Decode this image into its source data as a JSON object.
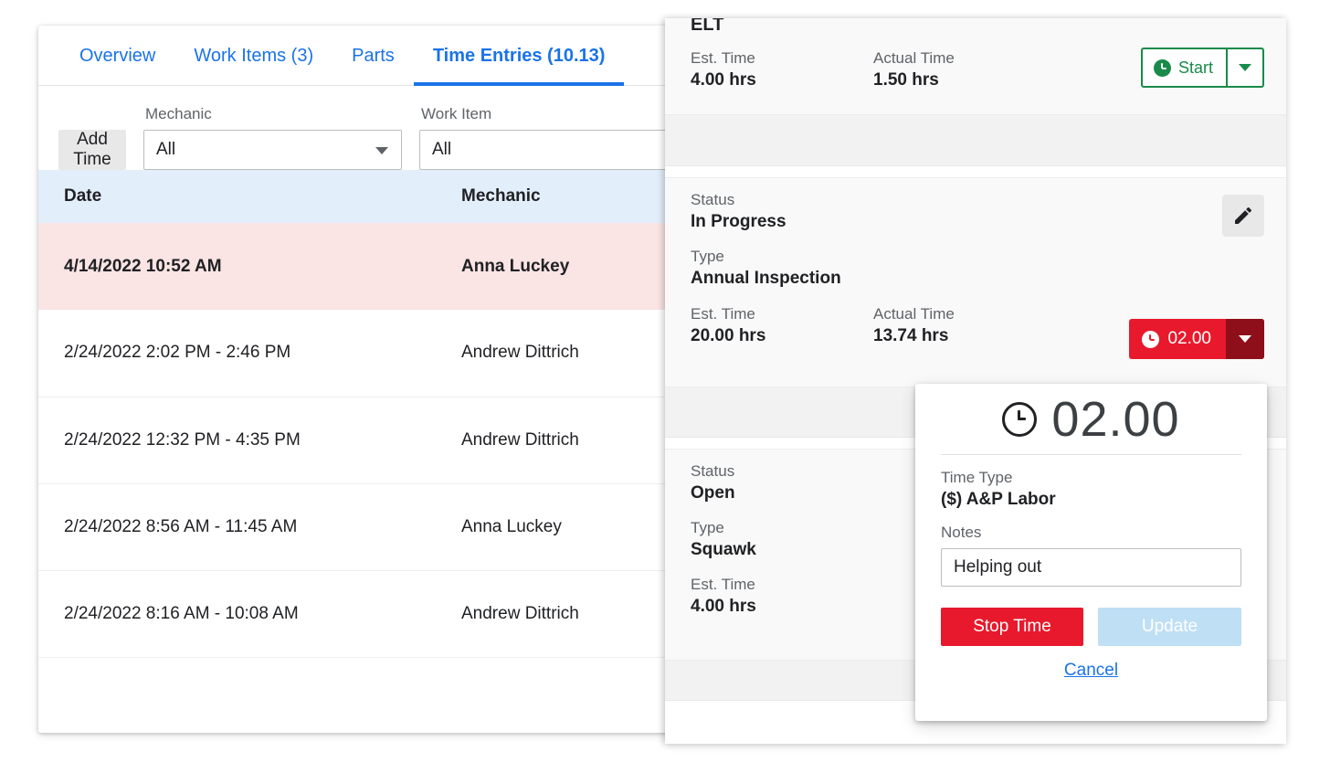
{
  "tabs": [
    {
      "label": "Overview",
      "active": false
    },
    {
      "label": "Work Items (3)",
      "active": false
    },
    {
      "label": "Parts",
      "active": false
    },
    {
      "label": "Time Entries (10.13)",
      "active": true
    }
  ],
  "toolbar": {
    "add_time_label": "Add Time",
    "mechanic_label": "Mechanic",
    "mechanic_value": "All",
    "work_item_label": "Work Item",
    "work_item_value": "All"
  },
  "table": {
    "columns": [
      "Date",
      "Mechanic"
    ],
    "rows": [
      {
        "date": "4/14/2022 10:52 AM",
        "mechanic": "Anna Luckey",
        "active": true
      },
      {
        "date": "2/24/2022 2:02 PM - 2:46 PM",
        "mechanic": "Andrew Dittrich",
        "active": false
      },
      {
        "date": "2/24/2022 12:32 PM - 4:35 PM",
        "mechanic": "Andrew Dittrich",
        "active": false
      },
      {
        "date": "2/24/2022 8:56 AM - 11:45 AM",
        "mechanic": "Anna Luckey",
        "active": false
      },
      {
        "date": "2/24/2022 8:16 AM - 10:08 AM",
        "mechanic": "Andrew Dittrich",
        "active": false
      }
    ]
  },
  "work_items": {
    "item1": {
      "title": "ELT",
      "est_label": "Est. Time",
      "est_value": "4.00 hrs",
      "actual_label": "Actual Time",
      "actual_value": "1.50 hrs",
      "start_label": "Start"
    },
    "item2": {
      "status_label": "Status",
      "status_value": "In Progress",
      "type_label": "Type",
      "type_value": "Annual Inspection",
      "est_label": "Est. Time",
      "est_value": "20.00 hrs",
      "actual_label": "Actual Time",
      "actual_value": "13.74 hrs",
      "timer_value": "02.00"
    },
    "item3": {
      "status_label": "Status",
      "status_value": "Open",
      "type_label": "Type",
      "type_value": "Squawk",
      "est_label": "Est. Time",
      "est_value": "4.00 hrs"
    }
  },
  "popover": {
    "timer_value": "02.00",
    "time_type_label": "Time Type",
    "time_type_value": "($) A&P Labor",
    "notes_label": "Notes",
    "notes_value": "Helping out",
    "notes_placeholder": "Notes",
    "stop_label": "Stop Time",
    "update_label": "Update",
    "cancel_label": "Cancel"
  },
  "colors": {
    "accent_blue": "#1a73e8",
    "header_blue": "#e3eefb",
    "active_row_red": "#fae4e4",
    "green": "#1a8a4a",
    "red": "#e8192c",
    "dark_red": "#8e0f19",
    "disabled_blue": "#bfdff5"
  }
}
